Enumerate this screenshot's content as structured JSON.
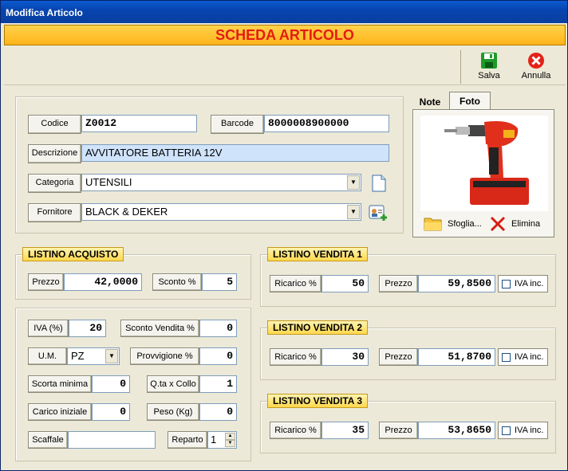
{
  "window": {
    "title": "Modifica Articolo"
  },
  "banner": {
    "text": "SCHEDA ARTICOLO"
  },
  "toolbar": {
    "save_label": "Salva",
    "cancel_label": "Annulla"
  },
  "article": {
    "code_label": "Codice",
    "code_value": "Z0012",
    "barcode_label": "Barcode",
    "barcode_value": "8000008900000",
    "description_label": "Descrizione",
    "description_value": "AVVITATORE BATTERIA 12V",
    "category_label": "Categoria",
    "category_value": "UTENSILI",
    "supplier_label": "Fornitore",
    "supplier_value": "BLACK & DEKER"
  },
  "photo_panel": {
    "tabs": [
      "Note",
      "Foto"
    ],
    "active_tab": "Foto",
    "browse_label": "Sfoglia...",
    "delete_label": "Elimina"
  },
  "purchase": {
    "title": "LISTINO ACQUISTO",
    "price_label": "Prezzo",
    "price_value": "42,0000",
    "discount_label": "Sconto %",
    "discount_value": "5"
  },
  "details": {
    "vat_label": "IVA (%)",
    "vat_value": "20",
    "sale_discount_label": "Sconto Vendita %",
    "sale_discount_value": "0",
    "um_label": "U.M.",
    "um_value": "PZ",
    "commission_label": "Provvigione %",
    "commission_value": "0",
    "min_stock_label": "Scorta minima",
    "min_stock_value": "0",
    "qty_pack_label": "Q.ta x Collo",
    "qty_pack_value": "1",
    "initial_load_label": "Carico iniziale",
    "initial_load_value": "0",
    "weight_label": "Peso (Kg)",
    "weight_value": "0",
    "shelf_label": "Scaffale",
    "shelf_value": "",
    "department_label": "Reparto",
    "department_value": "1"
  },
  "sales": [
    {
      "title": "LISTINO VENDITA 1",
      "markup_label": "Ricarico %",
      "markup_value": "50",
      "price_label": "Prezzo",
      "price_value": "59,8500",
      "vat_inc_label": "IVA inc.",
      "vat_inc_checked": false
    },
    {
      "title": "LISTINO VENDITA 2",
      "markup_label": "Ricarico %",
      "markup_value": "30",
      "price_label": "Prezzo",
      "price_value": "51,8700",
      "vat_inc_label": "IVA inc.",
      "vat_inc_checked": false
    },
    {
      "title": "LISTINO VENDITA 3",
      "markup_label": "Ricarico %",
      "markup_value": "35",
      "price_label": "Prezzo",
      "price_value": "53,8650",
      "vat_inc_label": "IVA inc.",
      "vat_inc_checked": false
    }
  ],
  "colors": {
    "title_bar": "#0a3e9e",
    "banner": "#ffc233",
    "banner_text": "#e41c12",
    "group_title": "#ffd84d",
    "highlight_field": "#cfe3fb"
  }
}
